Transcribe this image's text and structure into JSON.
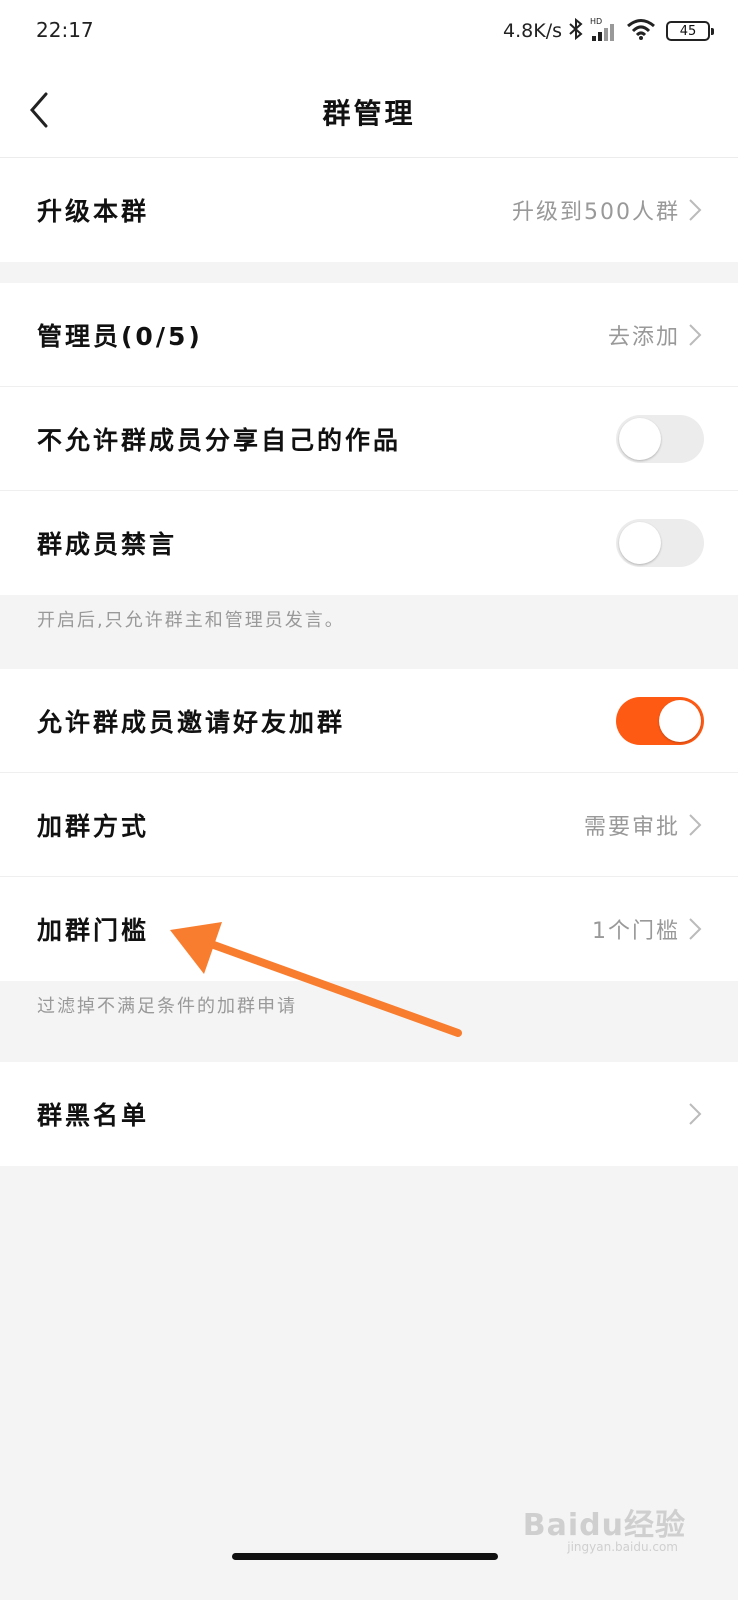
{
  "status_bar": {
    "time": "22:17",
    "network_speed": "4.8K/s",
    "network_badge": "HD",
    "battery": "45"
  },
  "header": {
    "title": "群管理"
  },
  "sections": {
    "upgrade": {
      "label": "升级本群",
      "value": "升级到500人群"
    },
    "admin": {
      "label": "管理员(0/5)",
      "value": "去添加"
    },
    "no_share": {
      "label": "不允许群成员分享自己的作品",
      "enabled": false
    },
    "mute": {
      "label": "群成员禁言",
      "enabled": false,
      "hint": "开启后,只允许群主和管理员发言。"
    },
    "allow_invite": {
      "label": "允许群成员邀请好友加群",
      "enabled": true
    },
    "join_method": {
      "label": "加群方式",
      "value": "需要审批"
    },
    "join_threshold": {
      "label": "加群门槛",
      "value": "1个门槛",
      "hint": "过滤掉不满足条件的加群申请"
    },
    "blacklist": {
      "label": "群黑名单"
    }
  },
  "watermark": {
    "text": "Baidu经验",
    "url": "jingyan.baidu.com"
  },
  "colors": {
    "accent": "#ff5a14",
    "annotation_arrow": "#f97d2e"
  }
}
